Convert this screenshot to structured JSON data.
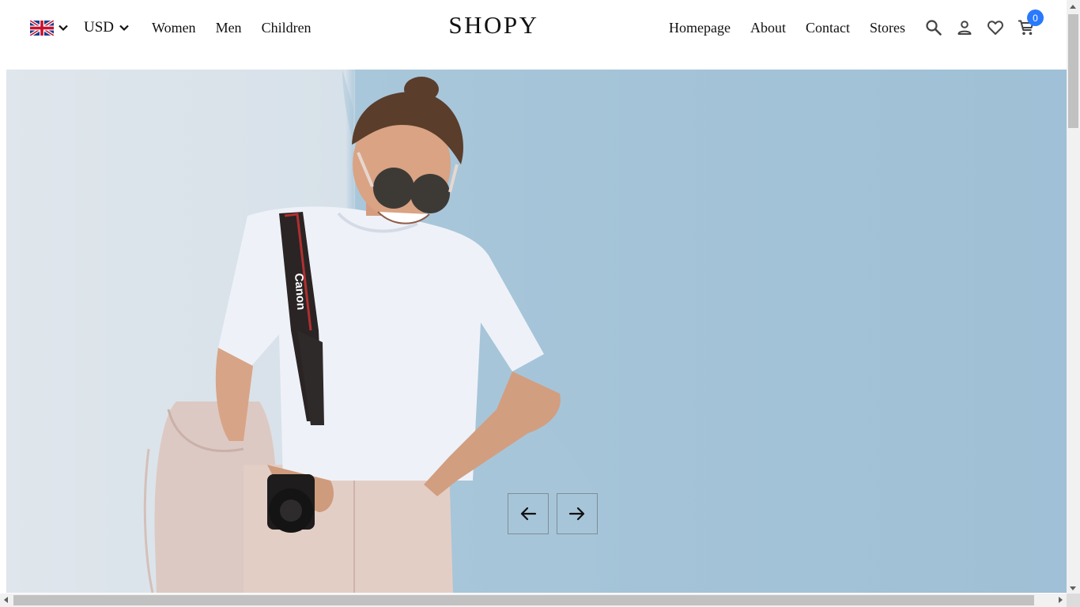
{
  "header": {
    "language": {
      "flag_icon": "uk-flag-icon",
      "dropdown_icon": "chevron-down-icon"
    },
    "currency": {
      "label": "USD",
      "dropdown_icon": "chevron-down-icon"
    },
    "left_nav": [
      {
        "label": "Women"
      },
      {
        "label": "Men"
      },
      {
        "label": "Children"
      }
    ],
    "logo": "SHOPY",
    "right_nav": [
      {
        "label": "Homepage"
      },
      {
        "label": "About"
      },
      {
        "label": "Contact"
      },
      {
        "label": "Stores"
      }
    ],
    "icons": [
      "search-icon",
      "user-icon",
      "heart-icon",
      "cart-icon"
    ],
    "cart_count": "0"
  },
  "hero": {
    "camera_strap_text": "Canon",
    "controls": {
      "prev_icon": "arrow-left-icon",
      "next_icon": "arrow-right-icon"
    }
  },
  "colors": {
    "accent": "#2879fe",
    "text": "#111111",
    "wall_blue": "#a4c3d8",
    "wall_white": "#dfe6ec"
  }
}
